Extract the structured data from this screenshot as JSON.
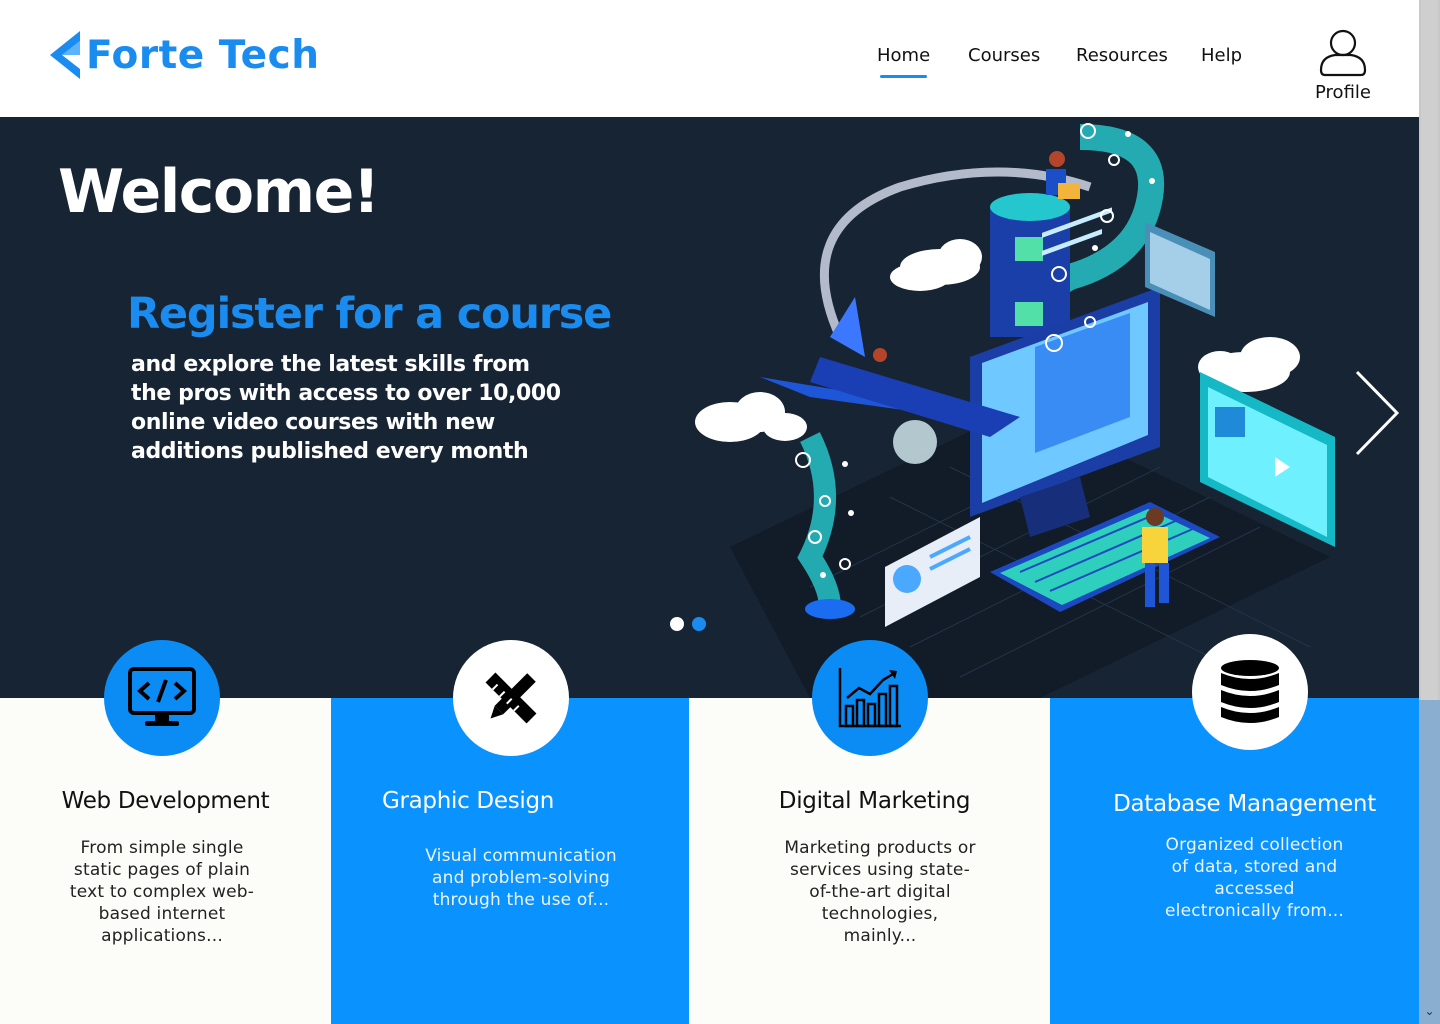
{
  "brand": {
    "name": "Forte Tech",
    "color": "#1a8cf0"
  },
  "nav": {
    "items": [
      {
        "label": "Home",
        "active": true
      },
      {
        "label": "Courses",
        "active": false
      },
      {
        "label": "Resources",
        "active": false
      },
      {
        "label": "Help",
        "active": false
      }
    ],
    "profile_label": "Profile",
    "profile_icon": "user-icon"
  },
  "hero": {
    "welcome": "Welcome!",
    "heading": "Register for a course",
    "subtext": "and explore the latest skills from the pros with access to over 10,000 online video courses with new additions published every month",
    "background_color": "#172433",
    "carousel": {
      "slides": 2,
      "active_slide": 2,
      "next_icon": "chevron-right-icon"
    }
  },
  "cards": [
    {
      "title": "Web Development",
      "description": "From simple single static pages of plain text to complex web-based internet applications...",
      "icon": "code-monitor-icon",
      "background": "#fcfdf8",
      "icon_background": "#0a8cf4",
      "text_color": "#111111"
    },
    {
      "title": "Graphic Design",
      "description": "Visual communication and problem-solving through the use of...",
      "icon": "pencil-ruler-icon",
      "background": "#0a92ff",
      "icon_background": "#ffffff",
      "text_color": "#ffffff"
    },
    {
      "title": "Digital Marketing",
      "description": "Marketing products or services using state-of-the-art digital technologies, mainly...",
      "icon": "bar-chart-growth-icon",
      "background": "#fcfdf8",
      "icon_background": "#0a8cf4",
      "text_color": "#111111"
    },
    {
      "title": "Database Management",
      "description": "Organized collection of data, stored and accessed electronically from...",
      "icon": "database-icon",
      "background": "#0a92ff",
      "icon_background": "#ffffff",
      "text_color": "#ffffff"
    }
  ]
}
